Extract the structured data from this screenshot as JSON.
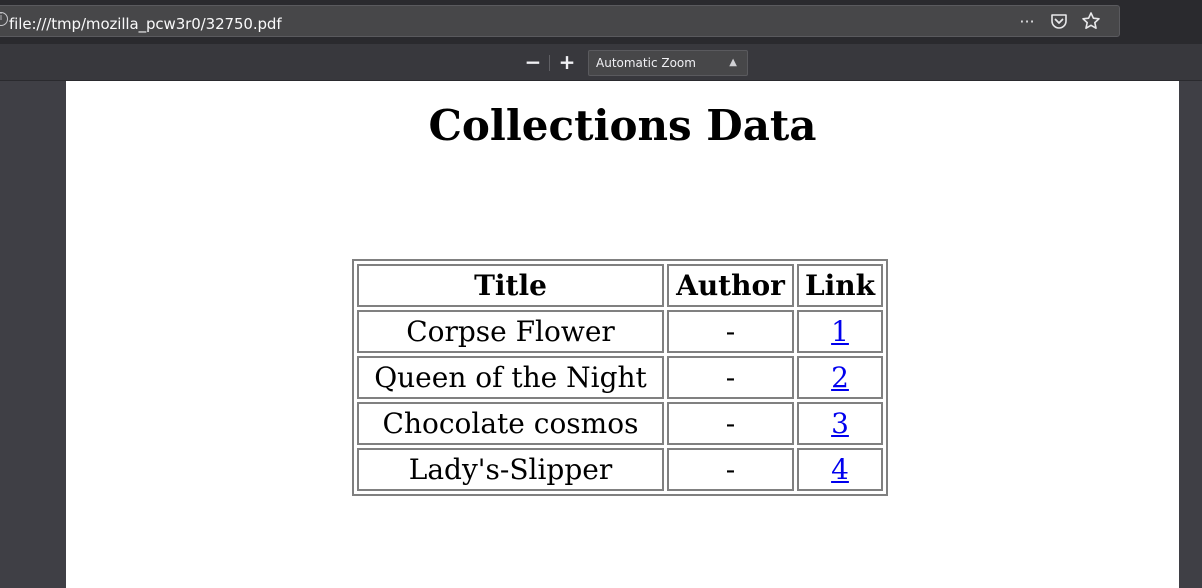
{
  "browser": {
    "url": "file:///tmp/mozilla_pcw3r0/32750.pdf",
    "page_actions": [
      "more-actions-icon",
      "pocket-icon",
      "bookmark-star-icon"
    ],
    "more_label": "···"
  },
  "pdf_toolbar": {
    "zoom_out_label": "−",
    "zoom_in_label": "+",
    "zoom_value": "Automatic Zoom"
  },
  "document": {
    "title": "Collections Data",
    "table": {
      "headers": [
        "Title",
        "Author",
        "Link"
      ],
      "rows": [
        {
          "title": "Corpse Flower",
          "author": "-",
          "link": "1"
        },
        {
          "title": "Queen of the Night",
          "author": "-",
          "link": "2"
        },
        {
          "title": "Chocolate cosmos",
          "author": "-",
          "link": "3"
        },
        {
          "title": "Lady's-Slipper",
          "author": "-",
          "link": "4"
        }
      ]
    }
  },
  "colors": {
    "link": "#0000ee",
    "toolbar_bg": "#38383d",
    "page_bg": "#ffffff"
  }
}
